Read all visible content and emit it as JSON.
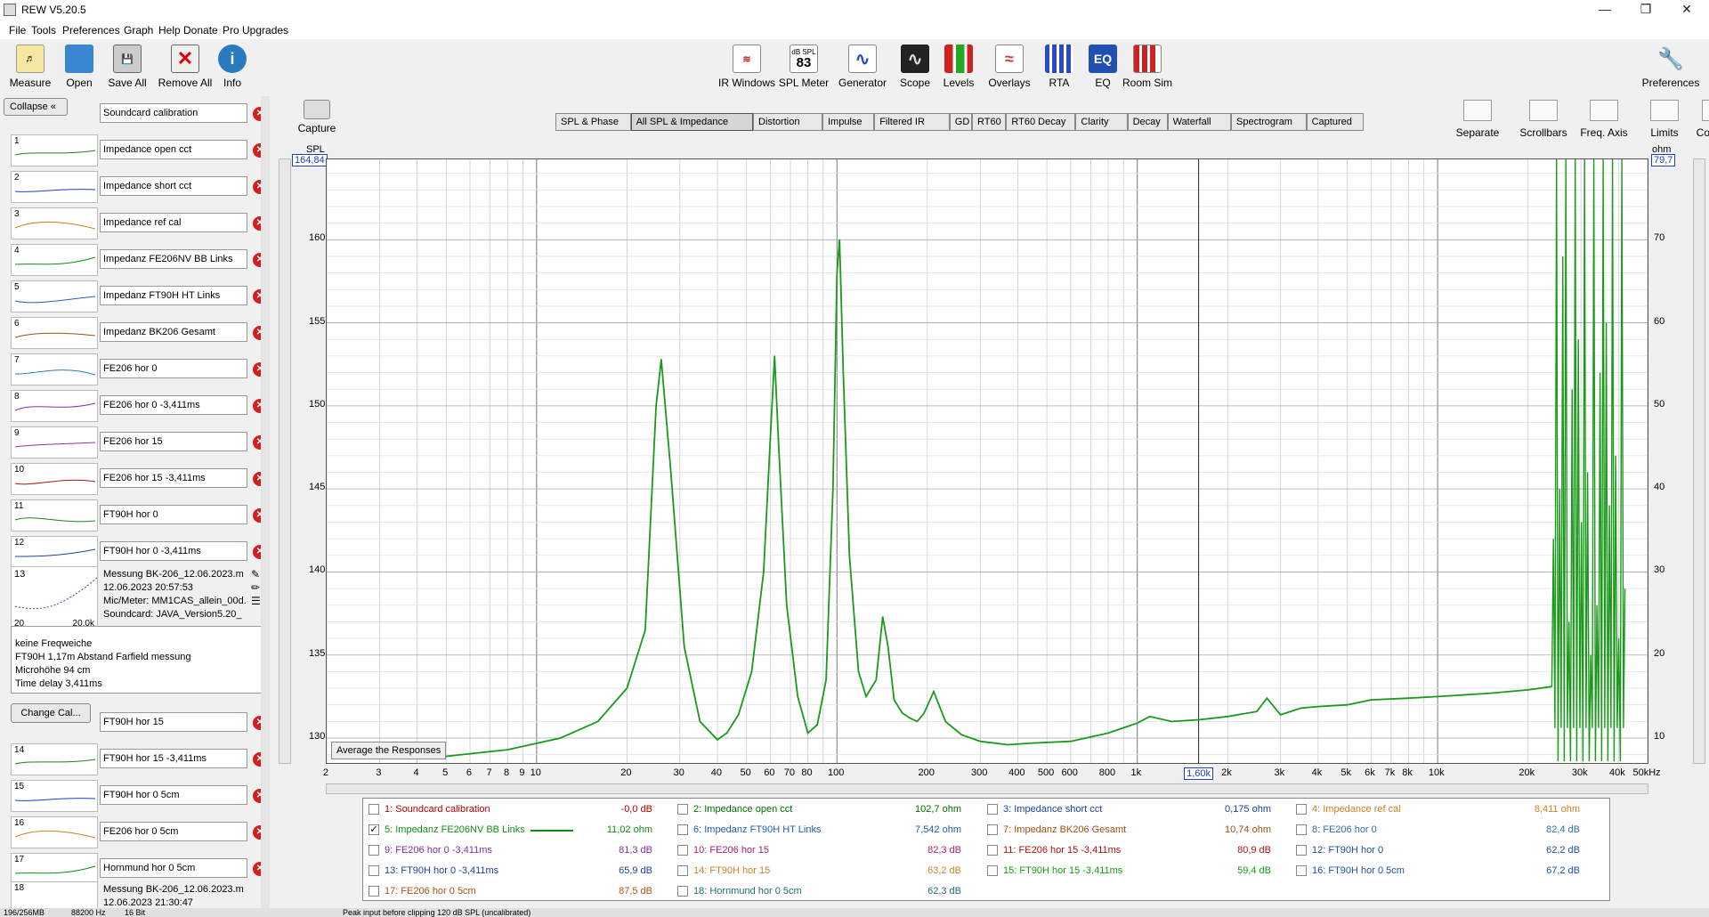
{
  "window": {
    "title": "REW V5.20.5"
  },
  "menu": [
    "File",
    "Tools",
    "Preferences",
    "Graph",
    "Help",
    "Donate",
    "Pro Upgrades"
  ],
  "toolbar_left": [
    "Measure",
    "Open",
    "Save All",
    "Remove All",
    "Info"
  ],
  "toolbar_center": [
    "IR Windows",
    "SPL Meter",
    "Generator",
    "Scope",
    "Levels",
    "Overlays",
    "RTA",
    "EQ",
    "Room Sim"
  ],
  "spl_meter_icon": {
    "top": "dB SPL",
    "value": "83"
  },
  "eq_icon_text": "EQ",
  "toolbar_right": "Preferences",
  "collapse_label": "Collapse",
  "capture_label": "Capture",
  "change_cal_label": "Change Cal...",
  "measurements": [
    {
      "n": "",
      "name": "Soundcard calibration"
    },
    {
      "n": "1",
      "name": "Impedance open cct"
    },
    {
      "n": "2",
      "name": "Impedance short cct"
    },
    {
      "n": "3",
      "name": "Impedance ref cal"
    },
    {
      "n": "4",
      "name": "Impedanz FE206NV BB Links"
    },
    {
      "n": "5",
      "name": "Impedanz FT90H HT Links"
    },
    {
      "n": "6",
      "name": "Impedanz BK206 Gesamt"
    },
    {
      "n": "7",
      "name": "FE206 hor 0"
    },
    {
      "n": "8",
      "name": "FE206 hor 0 -3,411ms"
    },
    {
      "n": "9",
      "name": "FE206 hor 15"
    },
    {
      "n": "10",
      "name": "FE206 hor 15 -3,411ms"
    },
    {
      "n": "11",
      "name": "FT90H hor 0"
    },
    {
      "n": "12",
      "name": "FT90H hor 0 -3,411ms"
    }
  ],
  "measurements_lower": [
    {
      "n": "",
      "name": "FT90H hor 15"
    },
    {
      "n": "14",
      "name": "FT90H hor 15 -3,411ms"
    },
    {
      "n": "15",
      "name": "FT90H hor 0 5cm"
    },
    {
      "n": "16",
      "name": "FE206 hor 0 5cm"
    },
    {
      "n": "17",
      "name": "Hornmund hor 0 5cm"
    }
  ],
  "selected": {
    "n": "13",
    "info": [
      "Messung BK-206_12.06.2023.m",
      "12.06.2023 20:57:53",
      "Mic/Meter: MM1CAS_allein_00d.",
      "Soundcard: JAVA_Version5.20_"
    ],
    "thumb_x": [
      "20",
      "20,0k"
    ],
    "notes": [
      "keine Freqweiche",
      "FT90H 1,17m Abstand Farfield messung",
      "Microhöhe 94 cm",
      "Time delay 3,411ms"
    ]
  },
  "item18": {
    "n": "18",
    "info": [
      "Messung BK-206_12.06.2023.m",
      "12.06.2023 21:30:47"
    ]
  },
  "graph_tabs": [
    "SPL & Phase",
    "All SPL & Impedance",
    "Distortion",
    "Impulse",
    "Filtered IR",
    "GD",
    "RT60",
    "RT60 Decay",
    "Clarity",
    "Decay",
    "Waterfall",
    "Spectrogram",
    "Captured"
  ],
  "active_tab": "All SPL & Impedance",
  "graph_tools": [
    "Separate",
    "Scrollbars",
    "Freq. Axis",
    "Limits",
    "Controls"
  ],
  "avg_button": "Average the Responses",
  "axes": {
    "left_unit": "SPL",
    "right_unit": "ohm",
    "left_top": "164,84",
    "right_top": "79,7",
    "left_ticks": [
      "160",
      "155",
      "150",
      "145",
      "140",
      "135",
      "130"
    ],
    "right_ticks": [
      "70",
      "60",
      "50",
      "40",
      "30",
      "20",
      "10"
    ],
    "x_ticks": [
      "2",
      "3",
      "4",
      "5",
      "6",
      "7",
      "8",
      "9",
      "10",
      "20",
      "30",
      "40",
      "50",
      "60",
      "70",
      "80",
      "100",
      "200",
      "300",
      "400",
      "500",
      "600",
      "800",
      "1k",
      "1,60k",
      "2k",
      "3k",
      "4k",
      "5k",
      "6k",
      "7k",
      "8k",
      "10k",
      "20k",
      "30k",
      "40k",
      "50kHz"
    ],
    "cursor_freq": "1,60k"
  },
  "chart_data": {
    "type": "line",
    "xscale": "log",
    "xlim": [
      2,
      50000
    ],
    "ylim": [
      128.5,
      164.84
    ],
    "grid": true,
    "series": [
      {
        "name": "5: Impedanz FE206NV BB Links",
        "color": "#1a9a1a",
        "x": [
          5,
          8,
          12,
          16,
          20,
          23,
          25,
          26,
          28,
          31,
          35,
          40,
          43,
          47,
          52,
          57,
          60,
          62,
          64,
          68,
          74,
          80,
          86,
          92,
          97,
          100,
          102,
          105,
          110,
          118,
          125,
          135,
          142,
          148,
          155,
          165,
          175,
          185,
          195,
          210,
          230,
          260,
          300,
          370,
          450,
          600,
          800,
          1000,
          1100,
          1300,
          1600,
          2000,
          2500,
          2700,
          3000,
          3500,
          4000,
          5000,
          6000,
          8000,
          10000,
          15000,
          20000,
          24000
        ],
        "y": [
          128.9,
          129.3,
          130.0,
          131.0,
          133.0,
          136.5,
          150.0,
          152.8,
          146.0,
          135.5,
          131.0,
          129.9,
          130.3,
          131.4,
          134.0,
          140.0,
          148.0,
          153.0,
          147.5,
          138.0,
          132.5,
          130.3,
          130.8,
          133.5,
          145.0,
          158.0,
          160.0,
          152.0,
          141.0,
          134.0,
          132.5,
          133.5,
          137.3,
          135.5,
          132.3,
          131.5,
          131.2,
          131.0,
          131.5,
          132.8,
          131.0,
          130.2,
          129.8,
          129.6,
          129.7,
          129.8,
          130.3,
          130.9,
          131.3,
          131.0,
          131.1,
          131.3,
          131.6,
          132.4,
          131.4,
          131.8,
          131.9,
          132.0,
          132.3,
          132.4,
          132.5,
          132.7,
          132.9,
          133.1
        ]
      }
    ]
  },
  "legend": [
    {
      "label": "1: Soundcard calibration",
      "value": "-0,0 dB",
      "color": "#c00000",
      "checked": false
    },
    {
      "label": "2: Impedance open cct",
      "value": "102,7 ohm",
      "color": "#007000",
      "checked": false
    },
    {
      "label": "3: Impedance short cct",
      "value": "0,175 ohm",
      "color": "#2040b0",
      "checked": false
    },
    {
      "label": "4: Impedance ref cal",
      "value": "8,411 ohm",
      "color": "#d08020",
      "checked": false
    },
    {
      "label": "5: Impedanz FE206NV BB Links",
      "value": "11,02 ohm",
      "color": "#109010",
      "checked": true
    },
    {
      "label": "6: Impedanz FT90H HT Links",
      "value": "7,542 ohm",
      "color": "#2060b0",
      "checked": false
    },
    {
      "label": "7: Impedanz BK206 Gesamt",
      "value": "10,74 ohm",
      "color": "#a05010",
      "checked": false
    },
    {
      "label": "8: FE206 hor 0",
      "value": "82,4 dB",
      "color": "#3070b0",
      "checked": false
    },
    {
      "label": "9: FE206 hor 0 -3,411ms",
      "value": "81,3 dB",
      "color": "#8030a0",
      "checked": false
    },
    {
      "label": "10: FE206 hor 15",
      "value": "82,3 dB",
      "color": "#a02080",
      "checked": false
    },
    {
      "label": "11: FE206 hor 15 -3,411ms",
      "value": "80,9 dB",
      "color": "#b01010",
      "checked": false
    },
    {
      "label": "12: FT90H hor 0",
      "value": "62,2 dB",
      "color": "#2050a0",
      "checked": false
    },
    {
      "label": "13: FT90H hor 0 -3,411ms",
      "value": "65,9 dB",
      "color": "#2040a0",
      "checked": false
    },
    {
      "label": "14: FT90H hor 15",
      "value": "63,2 dB",
      "color": "#d08020",
      "checked": false
    },
    {
      "label": "15: FT90H hor 15 -3,411ms",
      "value": "59,4 dB",
      "color": "#10a010",
      "checked": false
    },
    {
      "label": "16: FT90H hor 0 5cm",
      "value": "67,2 dB",
      "color": "#2050b0",
      "checked": false
    },
    {
      "label": "17: FE206 hor 0 5cm",
      "value": "87,5 dB",
      "color": "#b05010",
      "checked": false
    },
    {
      "label": "18: Hornmund hor 0 5cm",
      "value": "62,3 dB",
      "color": "#207070",
      "checked": false
    }
  ],
  "status": [
    "196/256MB",
    "88200 Hz",
    "16 Bit",
    "Peak input before clipping 120 dB SPL (uncalibrated)"
  ]
}
